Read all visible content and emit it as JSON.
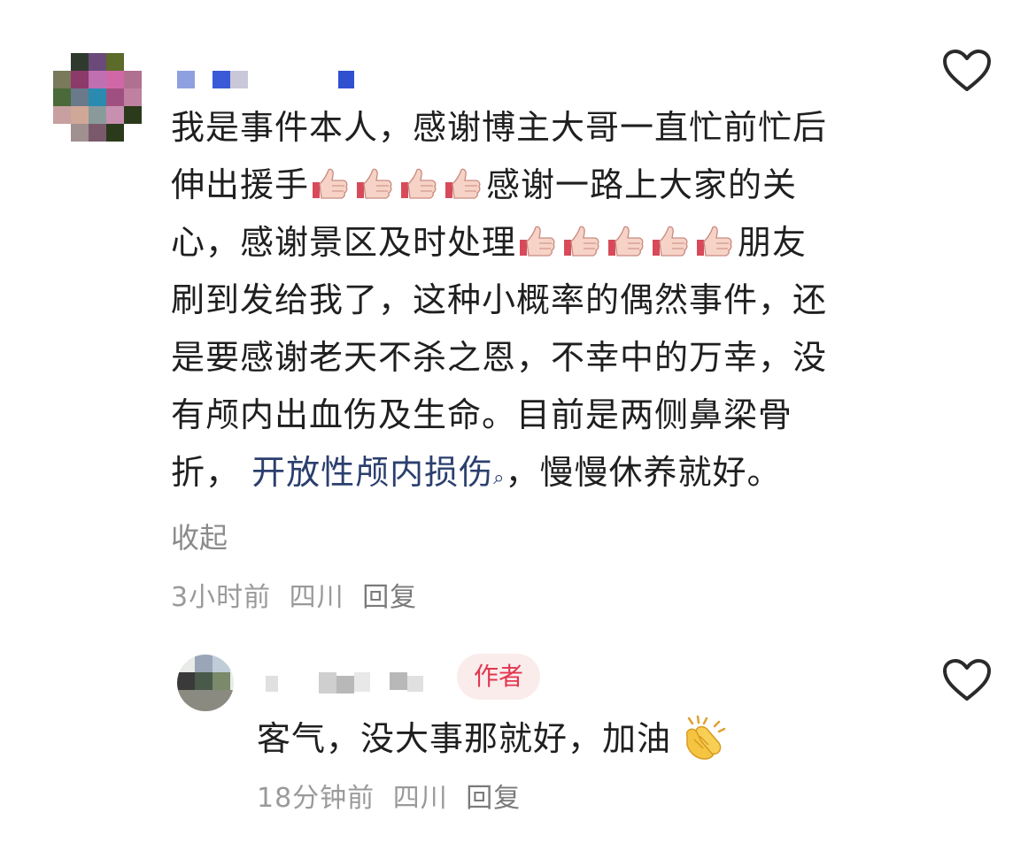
{
  "comment": {
    "lines_before_emoji_1": "我是事件本人，感谢博主大哥一直忙前忙后",
    "line2_prefix": "伸出援手",
    "line2_suffix": "感谢一路上大家的关",
    "line3_prefix": "心，感谢景区及时处理",
    "line3_suffix": "朋友",
    "line4": "刷到发给我了，这种小概率的偶然事件，还",
    "line5": "是要感谢老天不杀之恩，不幸中的万幸，没",
    "line6": "有颅内出血伤及生命。目前是两侧鼻梁骨",
    "line7_prefix": "折，",
    "line7_link": "开放性颅内损伤",
    "line7_suffix": "，慢慢休养就好。",
    "collapse_label": "收起",
    "time": "3小时前",
    "location": "四川",
    "reply_label": "回复",
    "emoji": "thumbs-up-emoji",
    "like_icon": "heart-outline-icon"
  },
  "reply": {
    "author_tag": "作者",
    "text": "客气，没大事那就好，加油",
    "emoji": "clapping-hands-emoji",
    "time": "18分钟前",
    "location": "四川",
    "reply_label": "回复",
    "like_icon": "heart-outline-icon"
  },
  "colors": {
    "text": "#1f1f1f",
    "meta": "#9a9a9a",
    "link": "#2b3f6e",
    "author_tag_bg": "#fbecec",
    "author_tag_text": "#e2374f"
  }
}
